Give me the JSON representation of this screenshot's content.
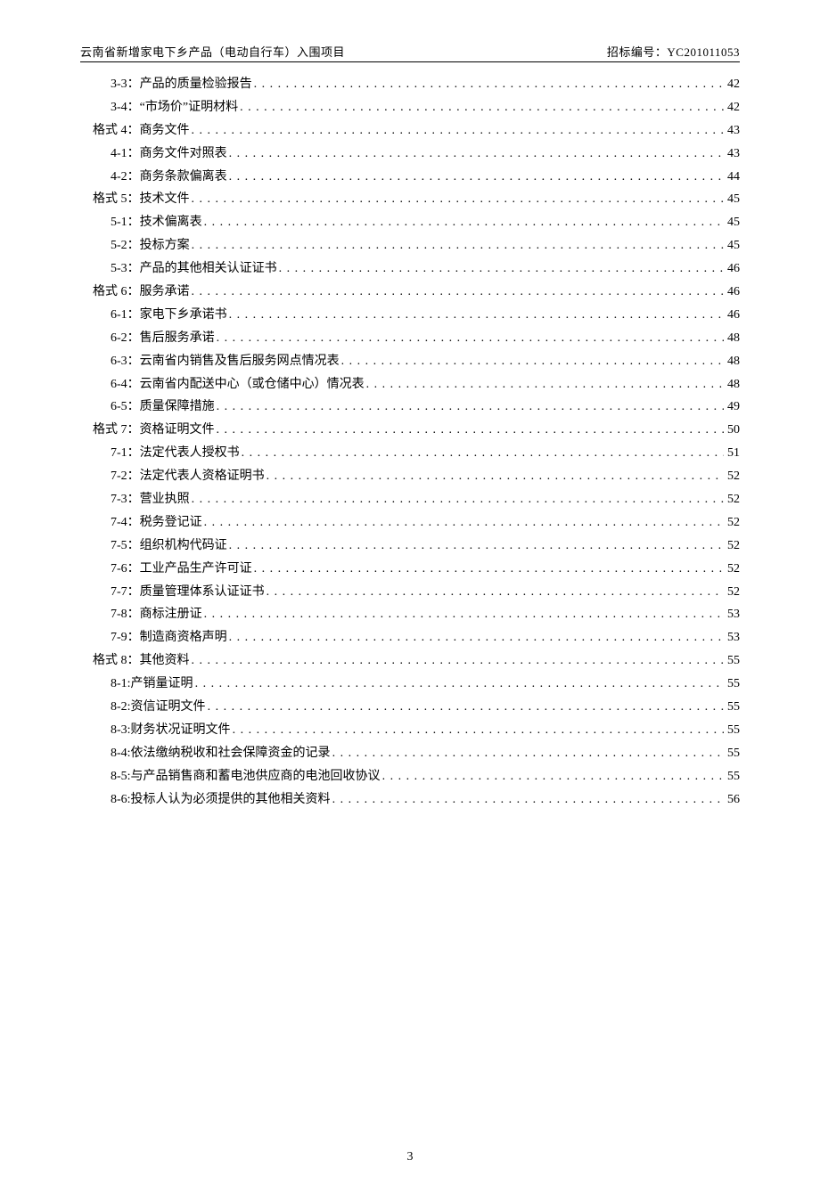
{
  "header": {
    "left": "云南省新增家电下乡产品（电动自行车）入围项目",
    "right_label": "招标编号：",
    "right_value": "YC201011053"
  },
  "toc": [
    {
      "level": 2,
      "label": "3-3：产品的质量检验报告",
      "page": "42"
    },
    {
      "level": 2,
      "label": "3-4：“市场价”证明材料",
      "page": "42"
    },
    {
      "level": 1,
      "label": "格式 4：商务文件",
      "page": "43"
    },
    {
      "level": 2,
      "label": "4-1：商务文件对照表",
      "page": "43"
    },
    {
      "level": 2,
      "label": "4-2：商务条款偏离表",
      "page": "44"
    },
    {
      "level": 1,
      "label": "格式 5：技术文件",
      "page": "45"
    },
    {
      "level": 2,
      "label": "5-1：技术偏离表",
      "page": "45"
    },
    {
      "level": 2,
      "label": "5-2：投标方案",
      "page": "45"
    },
    {
      "level": 2,
      "label": "5-3：产品的其他相关认证证书",
      "page": "46"
    },
    {
      "level": 1,
      "label": "格式 6：服务承诺",
      "page": "46"
    },
    {
      "level": 2,
      "label": "6-1：家电下乡承诺书",
      "page": "46"
    },
    {
      "level": 2,
      "label": "6-2：售后服务承诺",
      "page": "48"
    },
    {
      "level": 2,
      "label": "6-3：云南省内销售及售后服务网点情况表",
      "page": "48"
    },
    {
      "level": 2,
      "label": "6-4：云南省内配送中心（或仓储中心）情况表",
      "page": "48"
    },
    {
      "level": 2,
      "label": "6-5：质量保障措施",
      "page": "49"
    },
    {
      "level": 1,
      "label": "格式 7：资格证明文件",
      "page": "50"
    },
    {
      "level": 2,
      "label": "7-1：法定代表人授权书",
      "page": "51"
    },
    {
      "level": 2,
      "label": "7-2：法定代表人资格证明书",
      "page": "52"
    },
    {
      "level": 2,
      "label": "7-3：营业执照",
      "page": "52"
    },
    {
      "level": 2,
      "label": "7-4：税务登记证",
      "page": "52"
    },
    {
      "level": 2,
      "label": "7-5：组织机构代码证",
      "page": "52"
    },
    {
      "level": 2,
      "label": "7-6：工业产品生产许可证",
      "page": "52"
    },
    {
      "level": 2,
      "label": "7-7：质量管理体系认证证书",
      "page": "52"
    },
    {
      "level": 2,
      "label": "7-8：商标注册证",
      "page": "53"
    },
    {
      "level": 2,
      "label": "7-9：制造商资格声明",
      "page": "53"
    },
    {
      "level": 1,
      "label": "格式 8：其他资料",
      "page": "55"
    },
    {
      "level": 2,
      "label": "8-1:产销量证明",
      "page": "55"
    },
    {
      "level": 2,
      "label": "8-2:资信证明文件",
      "page": "55"
    },
    {
      "level": 2,
      "label": "8-3:财务状况证明文件",
      "page": "55"
    },
    {
      "level": 2,
      "label": "8-4:依法缴纳税收和社会保障资金的记录",
      "page": "55"
    },
    {
      "level": 2,
      "label": "8-5:与产品销售商和蓄电池供应商的电池回收协议",
      "page": "55"
    },
    {
      "level": 2,
      "label": "8-6:投标人认为必须提供的其他相关资料",
      "page": "56"
    }
  ],
  "page_number": "3"
}
